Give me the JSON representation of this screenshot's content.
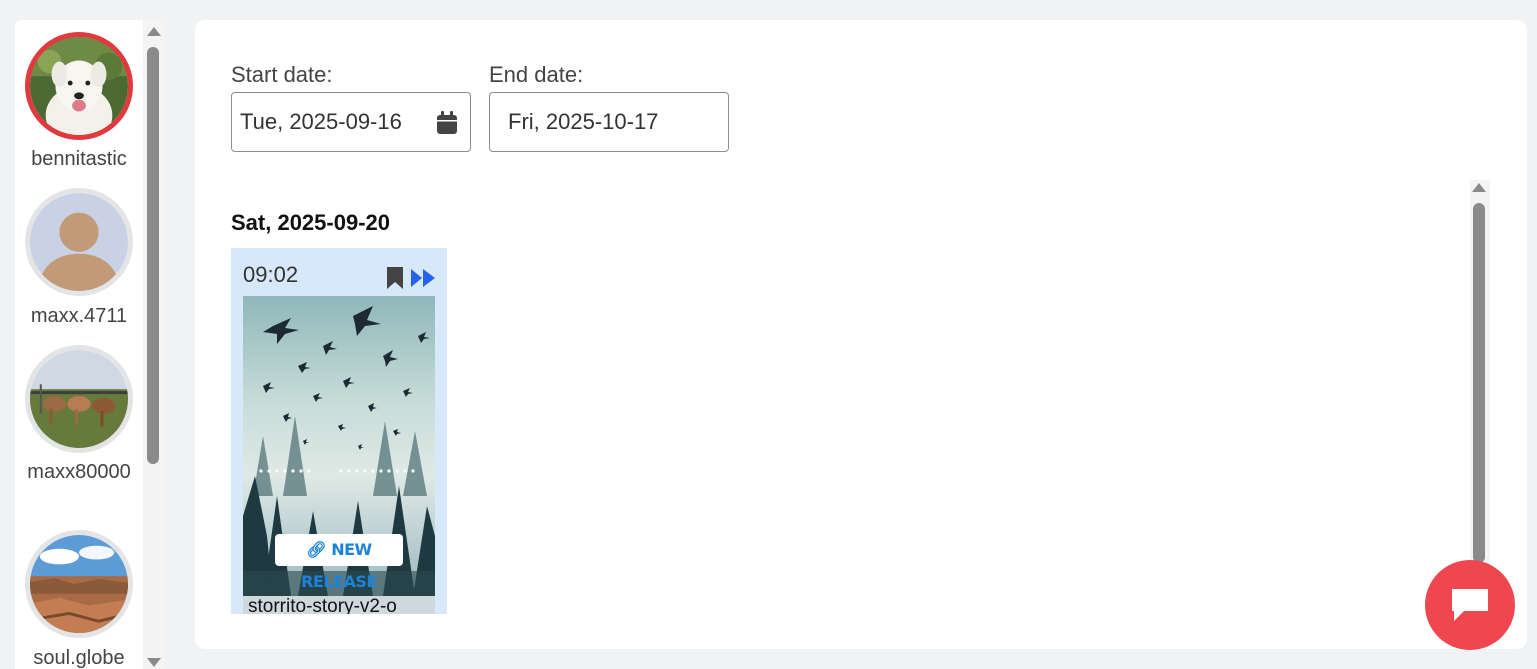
{
  "sidebar": {
    "users": [
      {
        "name": "bennitastic",
        "active": true,
        "avatar": "white-dog-photo"
      },
      {
        "name": "maxx.4711",
        "active": false,
        "avatar": "default-silhouette"
      },
      {
        "name": "maxx80000",
        "active": false,
        "avatar": "horses-photo"
      },
      {
        "name": "soul.globe",
        "active": false,
        "avatar": "canyon-photo"
      }
    ]
  },
  "filters": {
    "start_label": "Start date:",
    "start_value": "Tue, 2025-09-16",
    "end_label": "End date:",
    "end_value": "Fri, 2025-10-17"
  },
  "stories": {
    "day": "Sat, 2025-09-20",
    "items": [
      {
        "time": "09:02",
        "badge": "NEW RELEASE",
        "caption": "storrito-story-v2-o",
        "icons": [
          "bookmark-icon",
          "fast-forward-icon"
        ]
      }
    ]
  },
  "colors": {
    "active_ring": "#e03a3e",
    "card_bg": "#d7e8fb",
    "accent_blue": "#2563eb",
    "chat_button": "#f0464f"
  },
  "chat": {
    "icon": "chat-bubble-icon"
  }
}
